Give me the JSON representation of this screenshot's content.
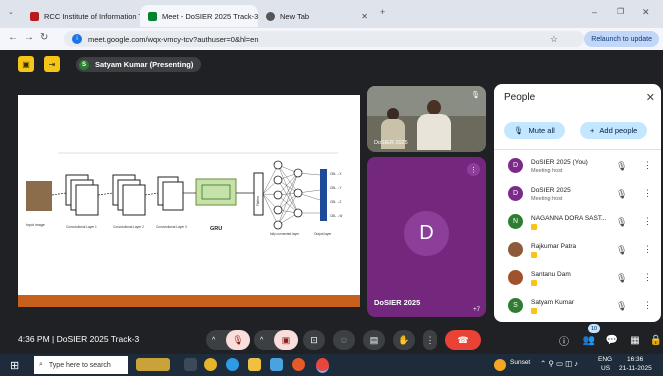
{
  "browser": {
    "tabs": [
      {
        "title": "RCC Institute of Information Te",
        "active": false
      },
      {
        "title": "Meet - DoSIER 2025 Track-3",
        "active": true
      },
      {
        "title": "New Tab",
        "active": false
      }
    ],
    "new_tab": "+",
    "url": "meet.google.com/wqx-vmcy-tcv?authuser=0&hl=en",
    "relaunch_label": "Relaunch to update"
  },
  "meet": {
    "presenting_avatar": "S",
    "presenting_label": "Satyam Kumar (Presenting)",
    "slide": {
      "labels": {
        "input": "Input image",
        "conv1": "Convolutional Layer 1",
        "conv2": "Convolutional Layer 2",
        "conv3": "Convolutional Layer 3",
        "gru": "GRU",
        "flatten": "Flatten",
        "fc": "fully connected layer",
        "output": "Output layer",
        "o1": "CBL→X",
        "o2": "CBL→Y",
        "o3": "CBL→Z",
        "o4": "CBL→W"
      }
    },
    "tiles": [
      {
        "name": "DoSIER 2025"
      },
      {
        "name": "DoSIER 2025",
        "avatar": "D",
        "more": "+7"
      }
    ],
    "meeting_info": "4:36 PM  |  DoSIER 2025 Track-3",
    "participants_badge": "10"
  },
  "people_panel": {
    "title": "People",
    "mute_all": "Mute all",
    "add_people": "Add people",
    "participants": [
      {
        "avatar": "D",
        "name": "DoSIER 2025 (You)",
        "sub": "Meeting host",
        "color": "#7b2a8a"
      },
      {
        "avatar": "D",
        "name": "DoSIER 2025",
        "sub": "Meeting host",
        "color": "#7b2a8a"
      },
      {
        "avatar": "N",
        "name": "NAGANNA DORA SAST...",
        "sub": "",
        "color": "#2e7d32"
      },
      {
        "avatar": "",
        "name": "Rajkumar Patra",
        "sub": "",
        "color": "#8d5a3b"
      },
      {
        "avatar": "",
        "name": "Santanu Dam",
        "sub": "",
        "color": "#a0522d"
      },
      {
        "avatar": "S",
        "name": "Satyam Kumar",
        "sub": "",
        "color": "#2e7d32"
      }
    ]
  },
  "taskbar": {
    "search_placeholder": "Type here to search",
    "weather": "Sunset",
    "lang": "ENG",
    "region": "US",
    "time": "16:36",
    "date": "21-11-2025"
  },
  "colors": {
    "accent": "#c2e7ff",
    "hangup": "#ea4335",
    "slide_bar": "#c6601c"
  }
}
